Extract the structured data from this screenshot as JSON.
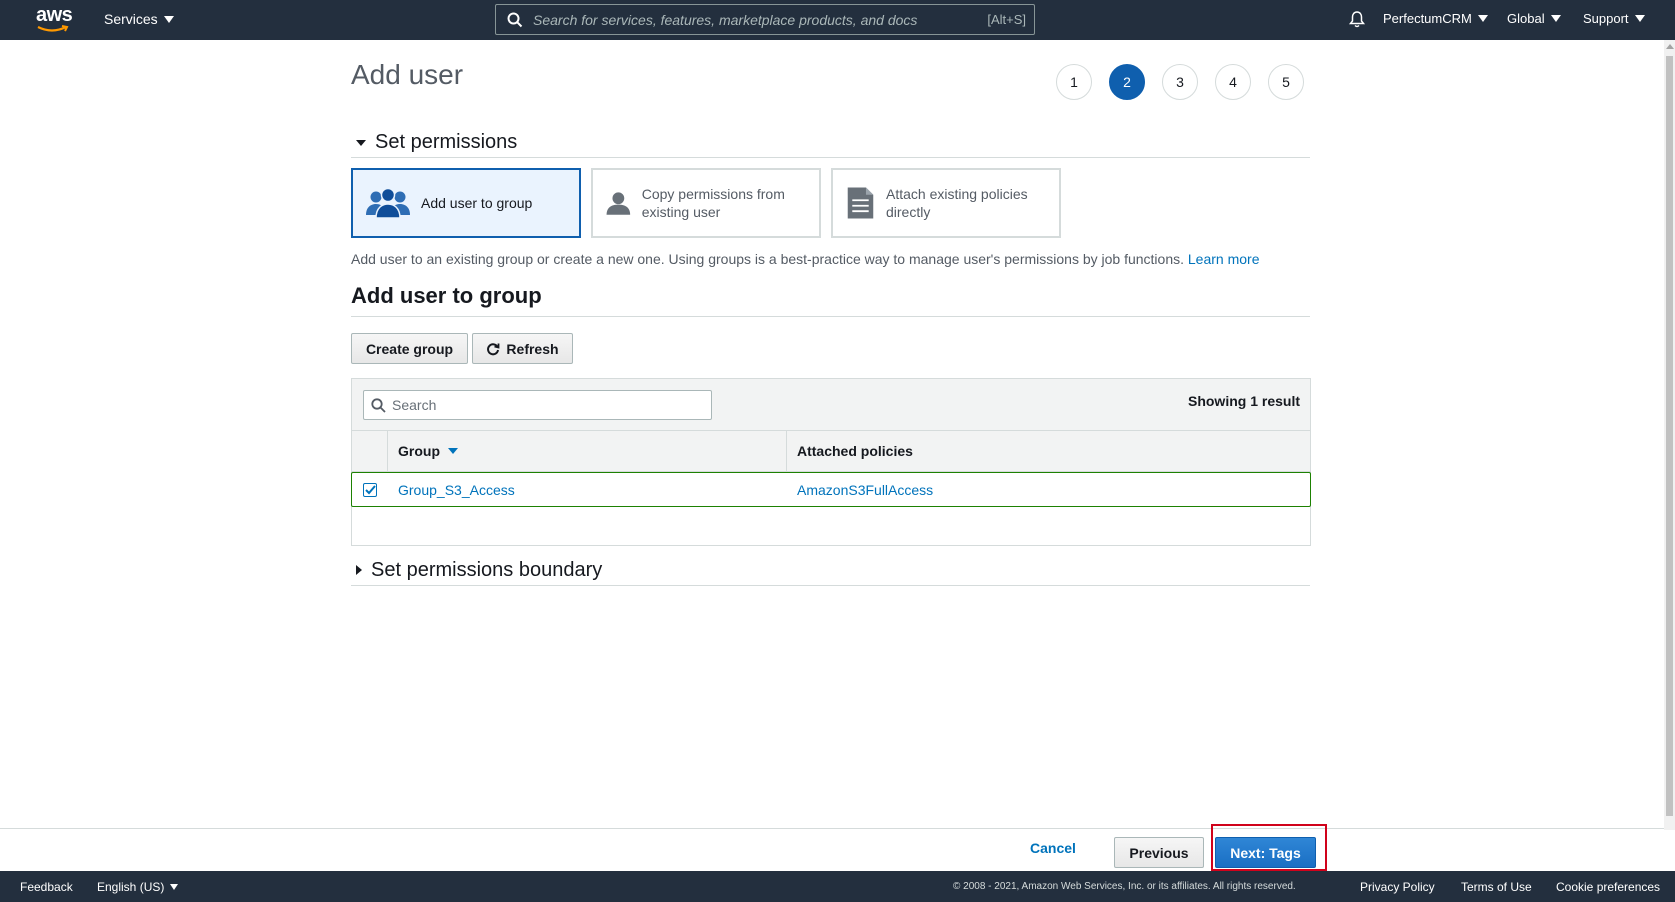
{
  "nav": {
    "logo": "aws",
    "services_label": "Services",
    "search_placeholder": "Search for services, features, marketplace products, and docs",
    "search_shortcut": "[Alt+S]",
    "account_label": "PerfectumCRM",
    "region_label": "Global",
    "support_label": "Support"
  },
  "page": {
    "title": "Add user",
    "steps": [
      "1",
      "2",
      "3",
      "4",
      "5"
    ],
    "active_step": "2"
  },
  "permissions": {
    "section_title": "Set permissions",
    "options": [
      {
        "label": "Add user to group",
        "icon": "group-icon",
        "selected": true
      },
      {
        "label": "Copy permissions from existing user",
        "icon": "user-icon",
        "selected": false
      },
      {
        "label": "Attach existing policies directly",
        "icon": "document-icon",
        "selected": false
      }
    ],
    "help_text": "Add user to an existing group or create a new one. Using groups is a best-practice way to manage user's permissions by job functions.",
    "learn_more": "Learn more"
  },
  "group_section": {
    "title": "Add user to group",
    "create_group_label": "Create group",
    "refresh_label": "Refresh",
    "search_placeholder": "Search",
    "result_count": "Showing 1 result",
    "columns": [
      "Group",
      "Attached policies"
    ],
    "rows": [
      {
        "group": "Group_S3_Access",
        "policies": "AmazonS3FullAccess",
        "checked": true
      }
    ]
  },
  "boundary": {
    "section_title": "Set permissions boundary"
  },
  "actions": {
    "cancel_label": "Cancel",
    "previous_label": "Previous",
    "next_label": "Next: Tags"
  },
  "footer": {
    "feedback": "Feedback",
    "language": "English (US)",
    "copyright": "© 2008 - 2021, Amazon Web Services, Inc. or its affiliates. All rights reserved.",
    "privacy": "Privacy Policy",
    "terms": "Terms of Use",
    "cookies": "Cookie preferences"
  },
  "colors": {
    "nav_bg": "#232f3e",
    "accent": "#0f5fae",
    "link": "#0073bb",
    "highlight": "#d0021b",
    "row_border": "#1d8102"
  }
}
